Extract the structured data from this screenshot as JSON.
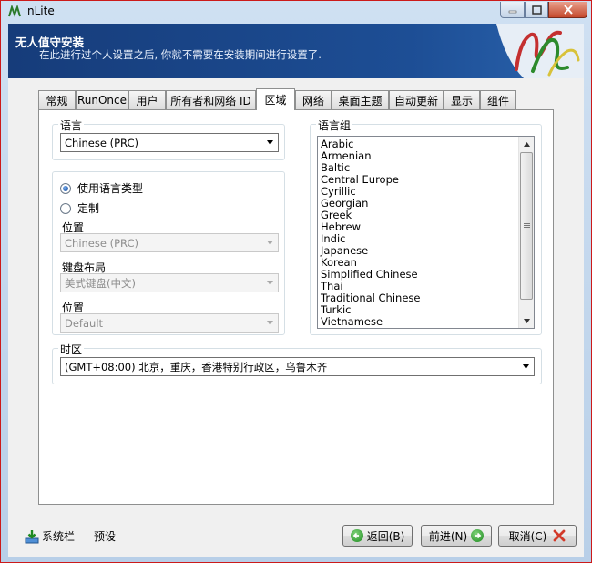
{
  "window": {
    "title": "nLite"
  },
  "banner": {
    "title": "无人值守安装",
    "subtitle": "在此进行过个人设置之后, 你就不需要在安装期间进行设置了."
  },
  "tabs": [
    {
      "label": "常规"
    },
    {
      "label": "RunOnce"
    },
    {
      "label": "用户"
    },
    {
      "label": "所有者和网络 ID"
    },
    {
      "label": "区域",
      "active": true
    },
    {
      "label": "网络"
    },
    {
      "label": "桌面主题"
    },
    {
      "label": "自动更新"
    },
    {
      "label": "显示"
    },
    {
      "label": "组件"
    }
  ],
  "language": {
    "group_label": "语言",
    "selected": "Chinese (PRC)"
  },
  "locale": {
    "radio_use_language_type": "使用语言类型",
    "radio_custom": "定制",
    "selected_mode": "使用语言类型",
    "location_label": "位置",
    "location_value": "Chinese (PRC)",
    "keyboard_label": "键盘布局",
    "keyboard_value": "美式键盘(中文)",
    "location2_label": "位置",
    "location2_value": "Default"
  },
  "language_groups": {
    "group_label": "语言组",
    "items": [
      "Arabic",
      "Armenian",
      "Baltic",
      "Central Europe",
      "Cyrillic",
      "Georgian",
      "Greek",
      "Hebrew",
      "Indic",
      "Japanese",
      "Korean",
      "Simplified Chinese",
      "Thai",
      "Traditional Chinese",
      "Turkic",
      "Vietnamese"
    ]
  },
  "timezone": {
    "group_label": "时区",
    "selected": "(GMT+08:00) 北京，重庆，香港特别行政区，乌鲁木齐"
  },
  "footer": {
    "tray_label": "系统栏",
    "preset_label": "预设",
    "back_label": "返回(B)",
    "next_label": "前进(N)",
    "cancel_label": "取消(C)"
  },
  "colors": {
    "banner": "#1d4e95",
    "window_border": "#cc1a1a",
    "accent_green": "#1d8a1f",
    "cancel_red": "#d23a2a"
  }
}
